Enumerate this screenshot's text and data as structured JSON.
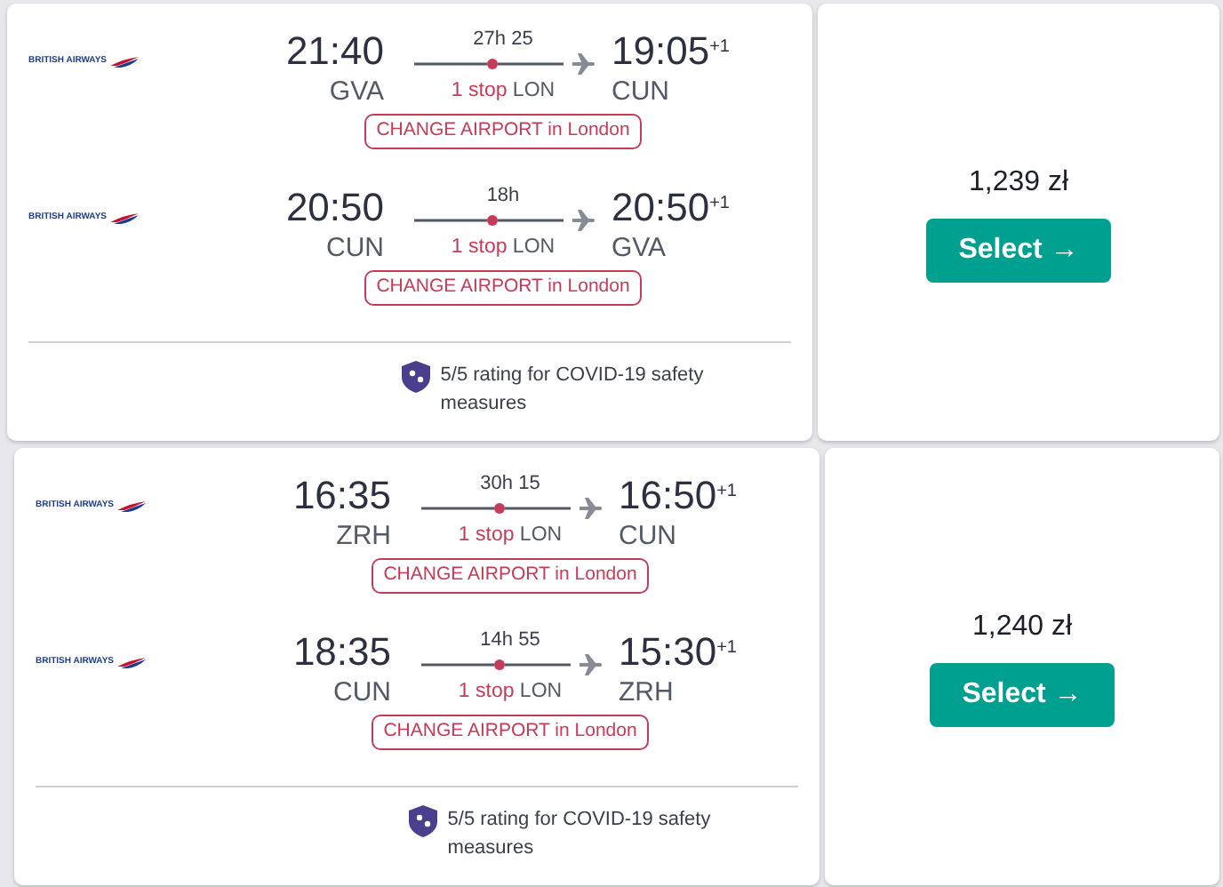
{
  "results": [
    {
      "segments": [
        {
          "airline": "BRITISH AIRWAYS",
          "departure_time": "21:40",
          "departure_airport": "GVA",
          "duration": "27h 25",
          "arrival_time": "19:05",
          "day_offset": "+1",
          "arrival_airport": "CUN",
          "stops": "1 stop",
          "stop_airport": "LON",
          "warning": "CHANGE AIRPORT in London"
        },
        {
          "airline": "BRITISH AIRWAYS",
          "departure_time": "20:50",
          "departure_airport": "CUN",
          "duration": "18h",
          "arrival_time": "20:50",
          "day_offset": "+1",
          "arrival_airport": "GVA",
          "stops": "1 stop",
          "stop_airport": "LON",
          "warning": "CHANGE AIRPORT in London"
        }
      ],
      "rating": "5/5 rating for COVID-19 safety measures",
      "price": "1,239 zł",
      "button": "Select →"
    },
    {
      "segments": [
        {
          "airline": "BRITISH AIRWAYS",
          "departure_time": "16:35",
          "departure_airport": "ZRH",
          "duration": "30h 15",
          "arrival_time": "16:50",
          "day_offset": "+1",
          "arrival_airport": "CUN",
          "stops": "1 stop",
          "stop_airport": "LON",
          "warning": "CHANGE AIRPORT in London"
        },
        {
          "airline": "BRITISH AIRWAYS",
          "departure_time": "18:35",
          "departure_airport": "CUN",
          "duration": "14h 55",
          "arrival_time": "15:30",
          "day_offset": "+1",
          "arrival_airport": "ZRH",
          "stops": "1 stop",
          "stop_airport": "LON",
          "warning": "CHANGE AIRPORT in London"
        }
      ],
      "rating": "5/5 rating for COVID-19 safety measures",
      "price": "1,240 zł",
      "button": "Select →"
    }
  ]
}
